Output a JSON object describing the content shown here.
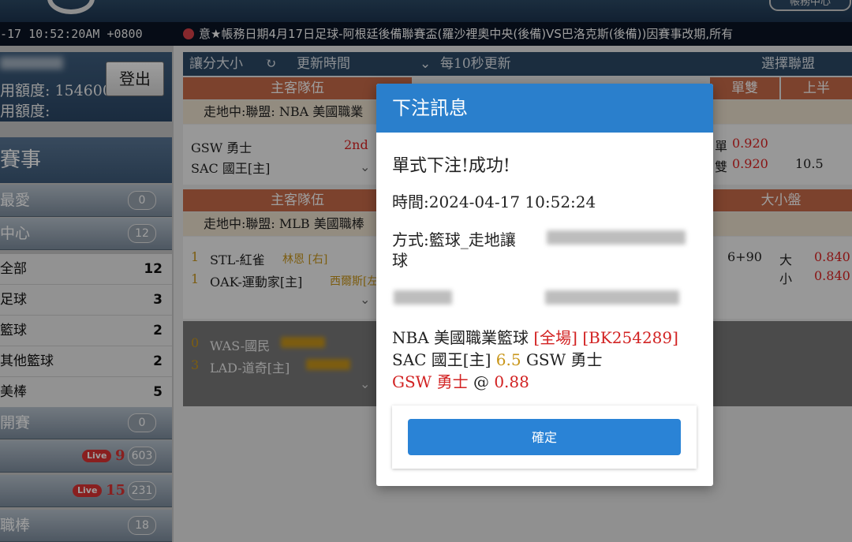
{
  "header": {
    "help_label": "帳務中心",
    "clock": "-17 10:52:20AM +0800",
    "ticker": "意★帳務日期4月17日足球-阿根廷後備聯賽盃(羅沙裡奧中央(後備)VS巴洛克斯(後備))因賽事改期,所有"
  },
  "sidebar": {
    "credit_label_1": "用額度: 154600",
    "credit_label_2": "用額度:",
    "logout_label": "登出",
    "events_title": "賽事",
    "items": [
      {
        "label": "最愛",
        "count": "0"
      },
      {
        "label": "中心",
        "count": "12"
      }
    ],
    "sports": [
      {
        "label": "全部",
        "count": "12"
      },
      {
        "label": "足球",
        "count": "3"
      },
      {
        "label": "籃球",
        "count": "2"
      },
      {
        "label": "其他籃球",
        "count": "2"
      },
      {
        "label": "美棒",
        "count": "5"
      }
    ],
    "bottom": [
      {
        "label": "開賽",
        "count": "0"
      },
      {
        "label": "",
        "live": "Live",
        "live_num": "9",
        "count": "603"
      },
      {
        "label": "",
        "live": "Live",
        "live_num": "15",
        "count": "231"
      },
      {
        "label": "職棒",
        "count": "18"
      }
    ]
  },
  "toolbar": {
    "handicap_label": "讓分大小",
    "refresh_icon": "refresh-icon",
    "update_time_label": "更新時間",
    "auto_refresh_label": "每10秒更新",
    "select_league_label": "選擇聯盟"
  },
  "board": {
    "col_team": "主客隊伍",
    "col_odd_even": "單雙",
    "col_first_half": "上半",
    "col_total": "大小盤",
    "league_nba": "走地中:聯盟: NBA 美國職業",
    "league_mlb": "走地中:聯盟: MLB 美國職棒",
    "nba_away": "GSW 勇士",
    "nba_home": "SAC 國王[主]",
    "nba_period": "2nd",
    "odd_label": "單",
    "even_label": "雙",
    "odd_val": "0.920",
    "even_val": "0.920",
    "nba_line": "10.5",
    "mlb_away_num": "1",
    "mlb_away": "STL-紅雀",
    "mlb_away_pitcher": "林恩 [右]",
    "mlb_home_num": "1",
    "mlb_home": "OAK-運動家[主]",
    "mlb_home_pitcher": "西爾斯[左]",
    "mlb_line": "6+90",
    "over_label": "大",
    "under_label": "小",
    "over_val": "0.840",
    "under_val": "0.840",
    "extra1_num": "0",
    "extra1": "WAS-國民",
    "extra2_num": "3",
    "extra2": "LAD-道奇[主]"
  },
  "modal": {
    "title": "下注訊息",
    "result": "單式下注!成功!",
    "time": "時間:2024-04-17 10:52:24",
    "method": "方式:籃球_走地讓",
    "method_wrap": "球",
    "league": "NBA 美國職業籃球",
    "tag_full": "[全場]",
    "ticket": "[BK254289]",
    "home": "SAC 國王[主]",
    "line": "6.5",
    "away": "GSW 勇士",
    "pick": "GSW 勇士",
    "at": "@",
    "price": "0.88",
    "confirm_label": "確定"
  },
  "colors": {
    "modal_header": "#2a7fcc",
    "confirm_button": "#2a83d6",
    "highlight_red": "#d22222",
    "line_gold": "#c9961a"
  }
}
